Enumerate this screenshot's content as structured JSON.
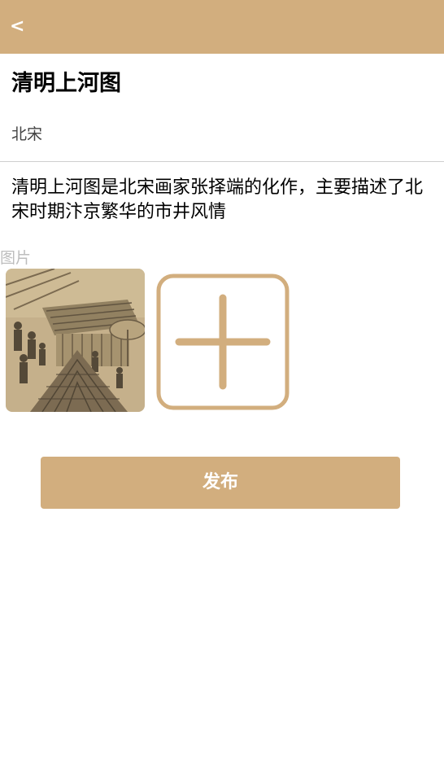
{
  "header": {
    "back_label": "<"
  },
  "artwork": {
    "title": "清明上河图",
    "dynasty": "北宋",
    "description": "清明上河图是北宋画家张择端的化作，主要描述了北宋时期汴京繁华的市井风情"
  },
  "images": {
    "label": "图片",
    "add_icon": "plus-icon"
  },
  "actions": {
    "publish_label": "发布"
  },
  "colors": {
    "accent": "#d2ae7e",
    "divider": "#cfcfcf",
    "muted_text": "#bdbdbd"
  }
}
